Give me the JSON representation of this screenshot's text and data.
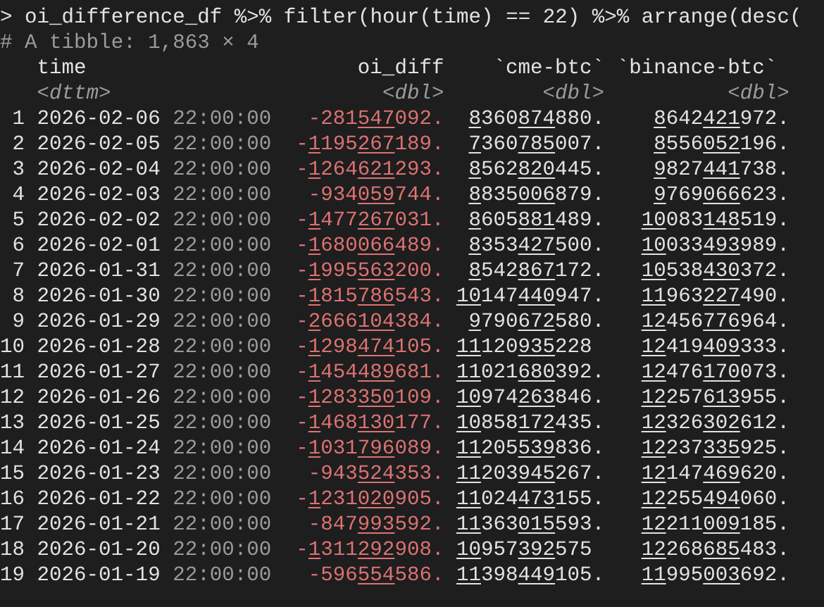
{
  "console": {
    "prompt": ">",
    "command": "oi_difference_df %>% filter(hour(time) == 22) %>% arrange(desc(",
    "summary": "# A tibble: 1,863 × 4"
  },
  "table": {
    "columns": [
      {
        "name": "time",
        "type": "<dttm>"
      },
      {
        "name": "oi_diff",
        "type": "<dbl>"
      },
      {
        "name": "`cme-btc`",
        "type": "<dbl>"
      },
      {
        "name": "`binance-btc`",
        "type": "<dbl>"
      }
    ],
    "rows": [
      {
        "index": "1",
        "time": "2026-02-06 22:00:00",
        "oi_diff": "-281547092.",
        "cme_btc": "8360874880.",
        "binance_btc": "8642421972."
      },
      {
        "index": "2",
        "time": "2026-02-05 22:00:00",
        "oi_diff": "-1195267189.",
        "cme_btc": "7360785007.",
        "binance_btc": "8556052196."
      },
      {
        "index": "3",
        "time": "2026-02-04 22:00:00",
        "oi_diff": "-1264621293.",
        "cme_btc": "8562820445.",
        "binance_btc": "9827441738."
      },
      {
        "index": "4",
        "time": "2026-02-03 22:00:00",
        "oi_diff": "-934059744.",
        "cme_btc": "8835006879.",
        "binance_btc": "9769066623."
      },
      {
        "index": "5",
        "time": "2026-02-02 22:00:00",
        "oi_diff": "-1477267031.",
        "cme_btc": "8605881489.",
        "binance_btc": "10083148519."
      },
      {
        "index": "6",
        "time": "2026-02-01 22:00:00",
        "oi_diff": "-1680066489.",
        "cme_btc": "8353427500.",
        "binance_btc": "10033493989."
      },
      {
        "index": "7",
        "time": "2026-01-31 22:00:00",
        "oi_diff": "-1995563200.",
        "cme_btc": "8542867172.",
        "binance_btc": "10538430372."
      },
      {
        "index": "8",
        "time": "2026-01-30 22:00:00",
        "oi_diff": "-1815786543.",
        "cme_btc": "10147440947.",
        "binance_btc": "11963227490."
      },
      {
        "index": "9",
        "time": "2026-01-29 22:00:00",
        "oi_diff": "-2666104384.",
        "cme_btc": "9790672580.",
        "binance_btc": "12456776964."
      },
      {
        "index": "10",
        "time": "2026-01-28 22:00:00",
        "oi_diff": "-1298474105.",
        "cme_btc": "11120935228",
        "binance_btc": "12419409333."
      },
      {
        "index": "11",
        "time": "2026-01-27 22:00:00",
        "oi_diff": "-1454489681.",
        "cme_btc": "11021680392.",
        "binance_btc": "12476170073."
      },
      {
        "index": "12",
        "time": "2026-01-26 22:00:00",
        "oi_diff": "-1283350109.",
        "cme_btc": "10974263846.",
        "binance_btc": "12257613955."
      },
      {
        "index": "13",
        "time": "2026-01-25 22:00:00",
        "oi_diff": "-1468130177.",
        "cme_btc": "10858172435.",
        "binance_btc": "12326302612."
      },
      {
        "index": "14",
        "time": "2026-01-24 22:00:00",
        "oi_diff": "-1031796089.",
        "cme_btc": "11205539836.",
        "binance_btc": "12237335925."
      },
      {
        "index": "15",
        "time": "2026-01-23 22:00:00",
        "oi_diff": "-943524353.",
        "cme_btc": "11203945267.",
        "binance_btc": "12147469620."
      },
      {
        "index": "16",
        "time": "2026-01-22 22:00:00",
        "oi_diff": "-1231020905.",
        "cme_btc": "11024473155.",
        "binance_btc": "12255494060."
      },
      {
        "index": "17",
        "time": "2026-01-21 22:00:00",
        "oi_diff": "-847993592.",
        "cme_btc": "11363015593.",
        "binance_btc": "12211009185."
      },
      {
        "index": "18",
        "time": "2026-01-20 22:00:00",
        "oi_diff": "-1311292908.",
        "cme_btc": "10957392575",
        "binance_btc": "12268685483."
      },
      {
        "index": "19",
        "time": "2026-01-19 22:00:00",
        "oi_diff": "-596554586.",
        "cme_btc": "11398449105.",
        "binance_btc": "11995003692."
      }
    ]
  }
}
